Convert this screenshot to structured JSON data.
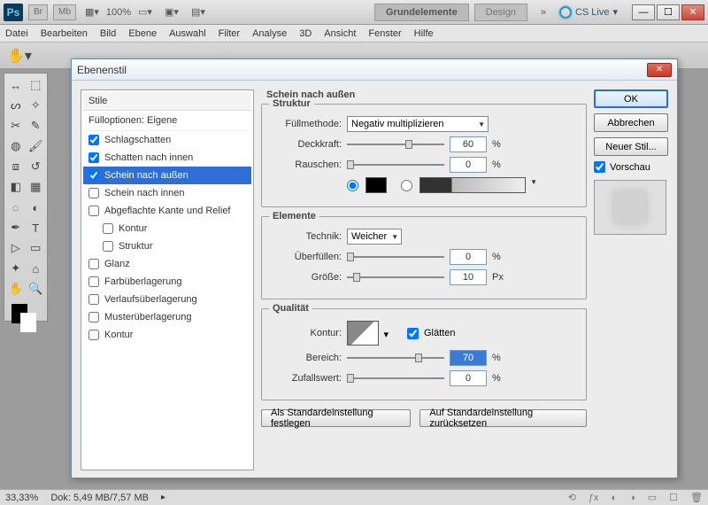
{
  "app": {
    "ps": "Ps",
    "br": "Br",
    "mb": "Mb",
    "zoom": "100%",
    "tab1": "Grundelemente",
    "tab2": "Design",
    "cslive": "CS Live"
  },
  "menu": [
    "Datei",
    "Bearbeiten",
    "Bild",
    "Ebene",
    "Auswahl",
    "Filter",
    "Analyse",
    "3D",
    "Ansicht",
    "Fenster",
    "Hilfe"
  ],
  "dialog": {
    "title": "Ebenenstil"
  },
  "stylesCol": {
    "header": "Stile",
    "sub": "Fülloptionen: Eigene",
    "items": [
      {
        "label": "Schlagschatten",
        "checked": true
      },
      {
        "label": "Schatten nach innen",
        "checked": true
      },
      {
        "label": "Schein nach außen",
        "checked": true,
        "selected": true
      },
      {
        "label": "Schein nach innen",
        "checked": false
      },
      {
        "label": "Abgeflachte Kante und Relief",
        "checked": false
      },
      {
        "label": "Kontur",
        "checked": false,
        "indent": true
      },
      {
        "label": "Struktur",
        "checked": false,
        "indent": true
      },
      {
        "label": "Glanz",
        "checked": false
      },
      {
        "label": "Farbüberlagerung",
        "checked": false
      },
      {
        "label": "Verlaufsüberlagerung",
        "checked": false
      },
      {
        "label": "Musterüberlagerung",
        "checked": false
      },
      {
        "label": "Kontur",
        "checked": false
      }
    ]
  },
  "panel": {
    "title": "Schein nach außen",
    "struct": {
      "title": "Struktur",
      "fullmethod_label": "Füllmethode:",
      "fullmethod_value": "Negativ multiplizieren",
      "deckkraft_label": "Deckkraft:",
      "deckkraft_value": "60",
      "deckkraft_unit": "%",
      "rauschen_label": "Rauschen:",
      "rauschen_value": "0",
      "rauschen_unit": "%"
    },
    "elements": {
      "title": "Elemente",
      "technik_label": "Technik:",
      "technik_value": "Weicher",
      "ueberfuellen_label": "Überfüllen:",
      "ueberfuellen_value": "0",
      "ueberfuellen_unit": "%",
      "groesse_label": "Größe:",
      "groesse_value": "10",
      "groesse_unit": "Px"
    },
    "qual": {
      "title": "Qualität",
      "kontur_label": "Kontur:",
      "glaetten_label": "Glätten",
      "bereich_label": "Bereich:",
      "bereich_value": "70",
      "bereich_unit": "%",
      "zufall_label": "Zufallswert:",
      "zufall_value": "0",
      "zufall_unit": "%"
    },
    "btn_default": "Als Standardeinstellung festlegen",
    "btn_reset": "Auf Standardeinstellung zurücksetzen"
  },
  "buttons": {
    "ok": "OK",
    "cancel": "Abbrechen",
    "newstyle": "Neuer Stil...",
    "vorschau": "Vorschau"
  },
  "status": {
    "zoom": "33,33%",
    "doc": "Dok: 5,49 MB/7,57 MB"
  }
}
